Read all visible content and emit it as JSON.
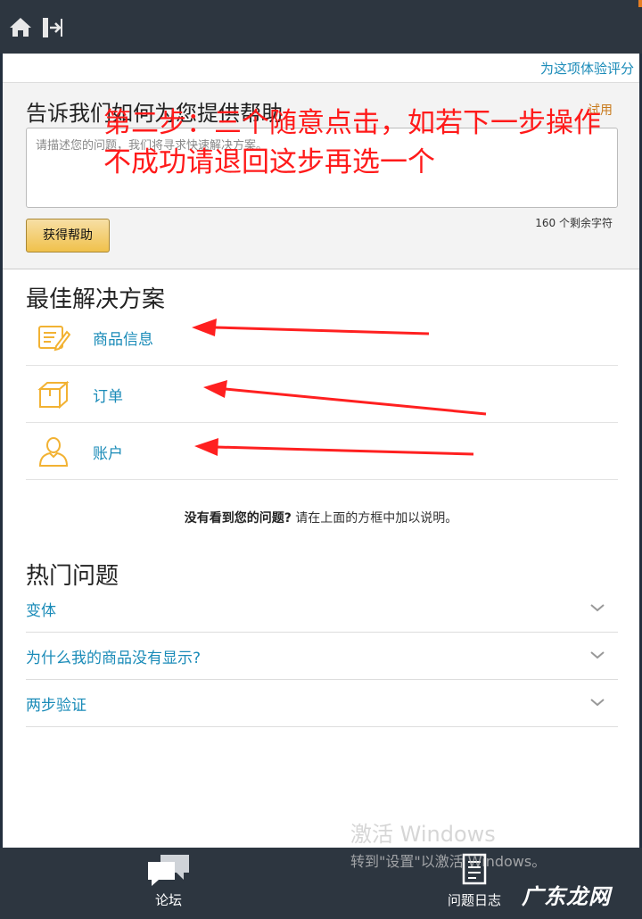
{
  "topbar": {
    "home_icon": "home-icon",
    "exit_icon": "exit-icon"
  },
  "rate_link": "为这项体验评分",
  "help": {
    "title": "告诉我们如何为您提供帮助",
    "try_link": "试用",
    "input_placeholder": "请描述您的问题，我们将寻求快速解决方案。",
    "button_label": "获得帮助",
    "char_count": "160  个剩余字符"
  },
  "overlay": {
    "line1": "第二步：三个随意点击，如若下一步操作",
    "line2": "不成功请退回这步再选一个",
    "color": "#ff1a1a"
  },
  "best_solutions": {
    "title": "最佳解决方案",
    "items": [
      {
        "label": "商品信息",
        "icon": "product-info-icon"
      },
      {
        "label": "订单",
        "icon": "order-box-icon"
      },
      {
        "label": "账户",
        "icon": "account-user-icon"
      }
    ]
  },
  "not_found": {
    "bold": "没有看到您的问题?",
    "text": " 请在上面的方框中加以说明。"
  },
  "hot_questions": {
    "title": "热门问题",
    "items": [
      {
        "label": "变体"
      },
      {
        "label": "为什么我的商品没有显示?"
      },
      {
        "label": "两步验证"
      }
    ]
  },
  "bottom_nav": {
    "forum": "论坛",
    "log": "问题日志"
  },
  "watermark": {
    "line1": "激活 Windows",
    "line2": "转到\"设置\"以激活 Windows。"
  },
  "corner_logo": "广东龙网",
  "colors": {
    "link": "#1a8bb8",
    "accent_orange": "#c87a1c",
    "button_gold": "#f0c14b",
    "icon_gold": "#f2b233",
    "bar": "#2d3640"
  }
}
